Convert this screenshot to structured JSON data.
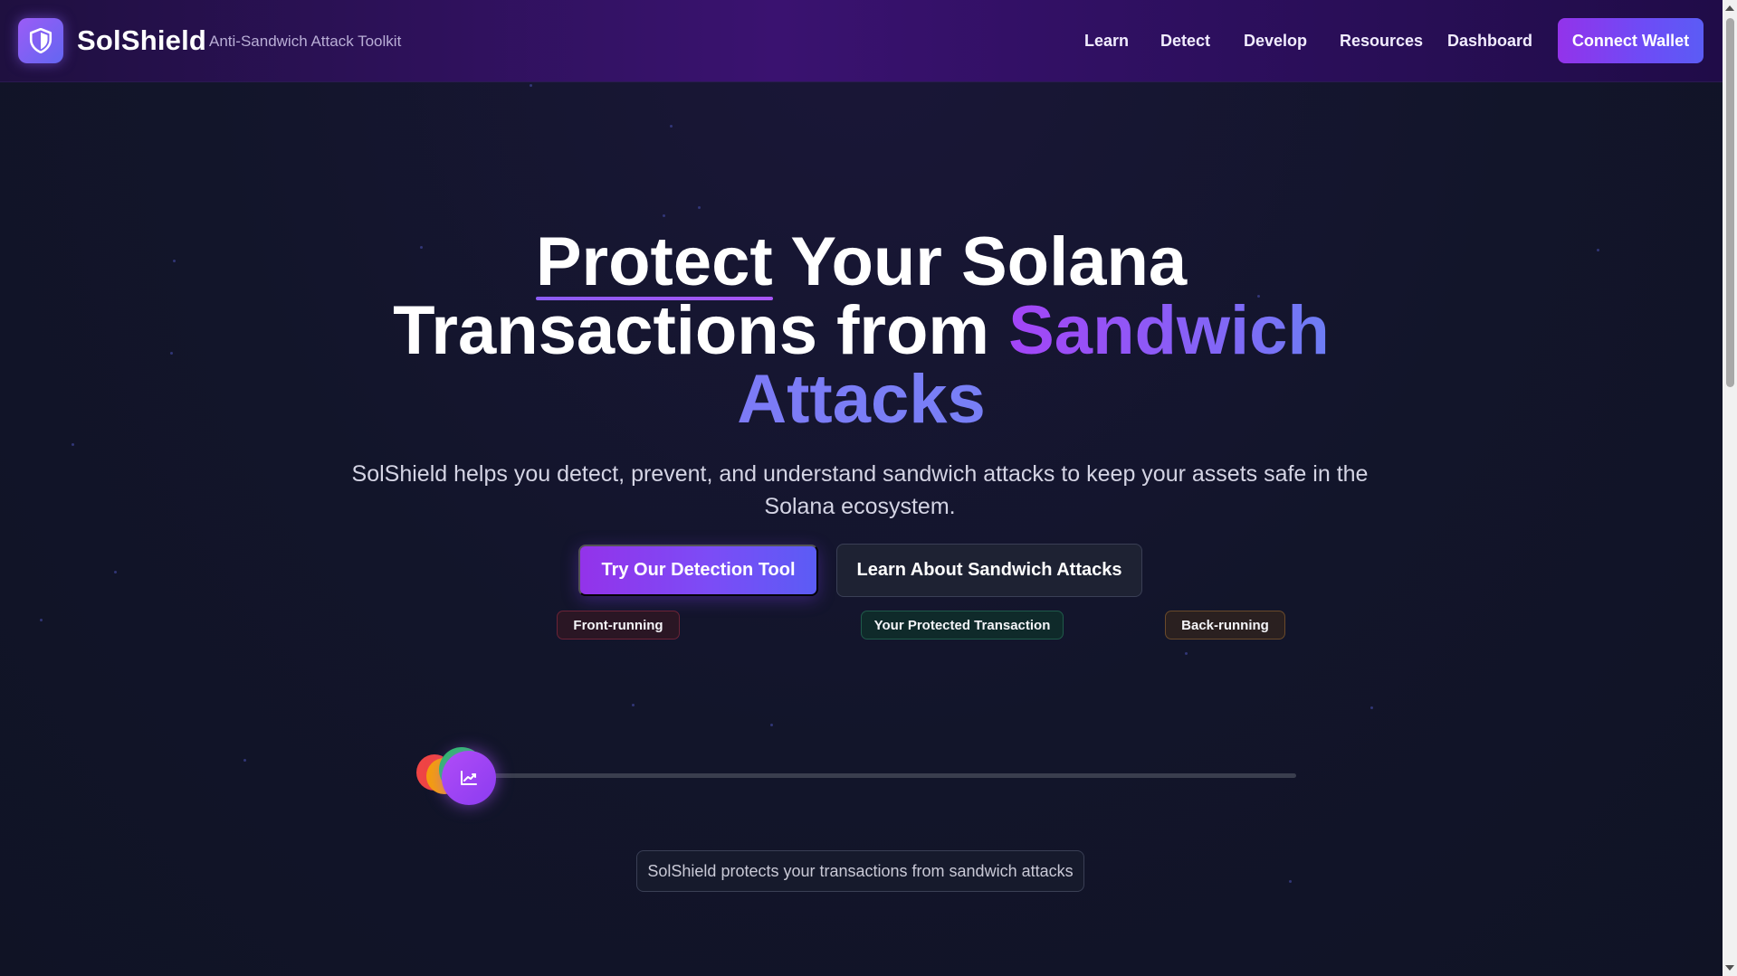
{
  "header": {
    "brand": "SolShield",
    "tagline": "Anti-Sandwich Attack Toolkit",
    "logo_icon": "shield-icon",
    "nav": [
      {
        "label": "Learn"
      },
      {
        "label": "Detect"
      },
      {
        "label": "Develop"
      },
      {
        "label": "Resources"
      },
      {
        "label": "Dashboard"
      }
    ],
    "connect_label": "Connect Wallet"
  },
  "hero": {
    "title_protect": "Protect",
    "title_rest_line1": " Your Solana",
    "title_line2_plain": "Transactions from ",
    "title_line2_grad": "Sandwich",
    "title_line3": "Attacks",
    "subtitle": "SolShield helps you detect, prevent, and understand sandwich attacks to keep your assets safe in the Solana ecosystem.",
    "primary_button": "Try Our Detection Tool",
    "secondary_button": "Learn About Sandwich Attacks"
  },
  "diagram": {
    "pills": {
      "front": "Front-running",
      "protected": "Your Protected Transaction",
      "back": "Back-running"
    },
    "main_icon": "chart-line-icon",
    "caption": "SolShield protects your transactions from sandwich attacks"
  },
  "colors": {
    "accent_purple": "#9333ea",
    "accent_blue": "#5b5cf5",
    "background": "#12152a",
    "front_running": "#ef4444",
    "protected": "#22c55e",
    "back_running": "#f59e0b"
  }
}
